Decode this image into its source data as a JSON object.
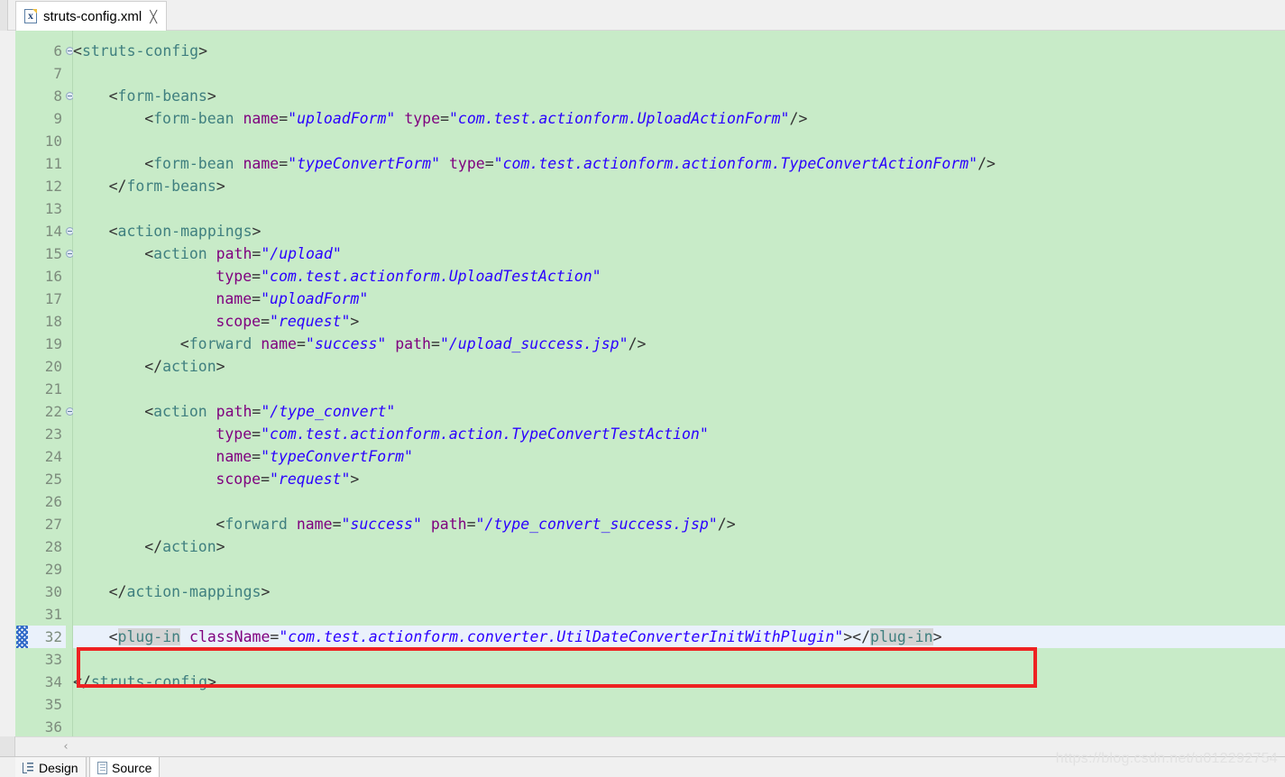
{
  "window": {
    "editor_tab": {
      "title": "struts-config.xml",
      "file_icon": "xml-file-icon",
      "close_icon": "close-icon"
    }
  },
  "editor": {
    "background_color": "#c8ebc8",
    "current_line_color": "#eaf1fb",
    "highlight_box_color": "#ee2222",
    "occurrence_color": "#d4d4d4",
    "colors": {
      "tag": "#3f7f7f",
      "attribute": "#7f007f",
      "value": "#2a00ff",
      "text": "#333333",
      "lineno": "#7d8c7d"
    },
    "first_line_number": 6,
    "current_line": 32,
    "lines": [
      {
        "n": 6,
        "fold": true,
        "indent": 0,
        "tokens": [
          {
            "t": "punc",
            "v": "<"
          },
          {
            "t": "tag",
            "v": "struts-config"
          },
          {
            "t": "punc",
            "v": ">"
          }
        ]
      },
      {
        "n": 7,
        "fold": false,
        "indent": 0,
        "tokens": []
      },
      {
        "n": 8,
        "fold": true,
        "indent": 1,
        "tokens": [
          {
            "t": "punc",
            "v": "<"
          },
          {
            "t": "tag",
            "v": "form-beans"
          },
          {
            "t": "punc",
            "v": ">"
          }
        ]
      },
      {
        "n": 9,
        "fold": false,
        "indent": 2,
        "tokens": [
          {
            "t": "punc",
            "v": "<"
          },
          {
            "t": "tag",
            "v": "form-bean"
          },
          {
            "t": "punc",
            "v": " "
          },
          {
            "t": "attr",
            "v": "name"
          },
          {
            "t": "punc",
            "v": "="
          },
          {
            "t": "val",
            "v": "\"uploadForm\""
          },
          {
            "t": "punc",
            "v": " "
          },
          {
            "t": "attr",
            "v": "type"
          },
          {
            "t": "punc",
            "v": "="
          },
          {
            "t": "val",
            "v": "\"com.test.actionform.UploadActionForm\""
          },
          {
            "t": "punc",
            "v": "/"
          },
          {
            "t": "punc",
            "v": ">"
          }
        ]
      },
      {
        "n": 10,
        "fold": false,
        "indent": 0,
        "tokens": []
      },
      {
        "n": 11,
        "fold": false,
        "indent": 2,
        "tokens": [
          {
            "t": "punc",
            "v": "<"
          },
          {
            "t": "tag",
            "v": "form-bean"
          },
          {
            "t": "punc",
            "v": " "
          },
          {
            "t": "attr",
            "v": "name"
          },
          {
            "t": "punc",
            "v": "="
          },
          {
            "t": "val",
            "v": "\"typeConvertForm\""
          },
          {
            "t": "punc",
            "v": " "
          },
          {
            "t": "attr",
            "v": "type"
          },
          {
            "t": "punc",
            "v": "="
          },
          {
            "t": "val",
            "v": "\"com.test.actionform.actionform.TypeConvertActionForm\""
          },
          {
            "t": "punc",
            "v": "/"
          },
          {
            "t": "punc",
            "v": ">"
          }
        ]
      },
      {
        "n": 12,
        "fold": false,
        "indent": 1,
        "tokens": [
          {
            "t": "punc",
            "v": "</"
          },
          {
            "t": "tag",
            "v": "form-beans"
          },
          {
            "t": "punc",
            "v": ">"
          }
        ]
      },
      {
        "n": 13,
        "fold": false,
        "indent": 0,
        "tokens": []
      },
      {
        "n": 14,
        "fold": true,
        "indent": 1,
        "tokens": [
          {
            "t": "punc",
            "v": "<"
          },
          {
            "t": "tag",
            "v": "action-mappings"
          },
          {
            "t": "punc",
            "v": ">"
          }
        ]
      },
      {
        "n": 15,
        "fold": true,
        "indent": 2,
        "tokens": [
          {
            "t": "punc",
            "v": "<"
          },
          {
            "t": "tag",
            "v": "action"
          },
          {
            "t": "punc",
            "v": " "
          },
          {
            "t": "attr",
            "v": "path"
          },
          {
            "t": "punc",
            "v": "="
          },
          {
            "t": "val",
            "v": "\"/upload\""
          }
        ]
      },
      {
        "n": 16,
        "fold": false,
        "indent": 4,
        "tokens": [
          {
            "t": "attr",
            "v": "type"
          },
          {
            "t": "punc",
            "v": "="
          },
          {
            "t": "val",
            "v": "\"com.test.actionform.UploadTestAction\""
          }
        ]
      },
      {
        "n": 17,
        "fold": false,
        "indent": 4,
        "tokens": [
          {
            "t": "attr",
            "v": "name"
          },
          {
            "t": "punc",
            "v": "="
          },
          {
            "t": "val",
            "v": "\"uploadForm\""
          }
        ]
      },
      {
        "n": 18,
        "fold": false,
        "indent": 4,
        "tokens": [
          {
            "t": "attr",
            "v": "scope"
          },
          {
            "t": "punc",
            "v": "="
          },
          {
            "t": "val",
            "v": "\"request\""
          },
          {
            "t": "punc",
            "v": ">"
          }
        ]
      },
      {
        "n": 19,
        "fold": false,
        "indent": 3,
        "tokens": [
          {
            "t": "punc",
            "v": "<"
          },
          {
            "t": "tag",
            "v": "forward"
          },
          {
            "t": "punc",
            "v": " "
          },
          {
            "t": "attr",
            "v": "name"
          },
          {
            "t": "punc",
            "v": "="
          },
          {
            "t": "val",
            "v": "\"success\""
          },
          {
            "t": "punc",
            "v": " "
          },
          {
            "t": "attr",
            "v": "path"
          },
          {
            "t": "punc",
            "v": "="
          },
          {
            "t": "val",
            "v": "\"/upload_success.jsp\""
          },
          {
            "t": "punc",
            "v": "/"
          },
          {
            "t": "punc",
            "v": ">"
          }
        ]
      },
      {
        "n": 20,
        "fold": false,
        "indent": 2,
        "tokens": [
          {
            "t": "punc",
            "v": "</"
          },
          {
            "t": "tag",
            "v": "action"
          },
          {
            "t": "punc",
            "v": ">"
          }
        ]
      },
      {
        "n": 21,
        "fold": false,
        "indent": 0,
        "tokens": []
      },
      {
        "n": 22,
        "fold": true,
        "indent": 2,
        "tokens": [
          {
            "t": "punc",
            "v": "<"
          },
          {
            "t": "tag",
            "v": "action"
          },
          {
            "t": "punc",
            "v": " "
          },
          {
            "t": "attr",
            "v": "path"
          },
          {
            "t": "punc",
            "v": "="
          },
          {
            "t": "val",
            "v": "\"/type_convert\""
          }
        ]
      },
      {
        "n": 23,
        "fold": false,
        "indent": 4,
        "tokens": [
          {
            "t": "attr",
            "v": "type"
          },
          {
            "t": "punc",
            "v": "="
          },
          {
            "t": "val",
            "v": "\"com.test.actionform.action.TypeConvertTestAction\""
          }
        ]
      },
      {
        "n": 24,
        "fold": false,
        "indent": 4,
        "tokens": [
          {
            "t": "attr",
            "v": "name"
          },
          {
            "t": "punc",
            "v": "="
          },
          {
            "t": "val",
            "v": "\"typeConvertForm\""
          }
        ]
      },
      {
        "n": 25,
        "fold": false,
        "indent": 4,
        "tokens": [
          {
            "t": "attr",
            "v": "scope"
          },
          {
            "t": "punc",
            "v": "="
          },
          {
            "t": "val",
            "v": "\"request\""
          },
          {
            "t": "punc",
            "v": ">"
          }
        ]
      },
      {
        "n": 26,
        "fold": false,
        "indent": 0,
        "tokens": []
      },
      {
        "n": 27,
        "fold": false,
        "indent": 4,
        "tokens": [
          {
            "t": "punc",
            "v": "<"
          },
          {
            "t": "tag",
            "v": "forward"
          },
          {
            "t": "punc",
            "v": " "
          },
          {
            "t": "attr",
            "v": "name"
          },
          {
            "t": "punc",
            "v": "="
          },
          {
            "t": "val",
            "v": "\"success\""
          },
          {
            "t": "punc",
            "v": " "
          },
          {
            "t": "attr",
            "v": "path"
          },
          {
            "t": "punc",
            "v": "="
          },
          {
            "t": "val",
            "v": "\"/type_convert_success.jsp\""
          },
          {
            "t": "punc",
            "v": "/"
          },
          {
            "t": "punc",
            "v": ">"
          }
        ]
      },
      {
        "n": 28,
        "fold": false,
        "indent": 2,
        "tokens": [
          {
            "t": "punc",
            "v": "</"
          },
          {
            "t": "tag",
            "v": "action"
          },
          {
            "t": "punc",
            "v": ">"
          }
        ]
      },
      {
        "n": 29,
        "fold": false,
        "indent": 0,
        "tokens": []
      },
      {
        "n": 30,
        "fold": false,
        "indent": 1,
        "tokens": [
          {
            "t": "punc",
            "v": "</"
          },
          {
            "t": "tag",
            "v": "action-mappings"
          },
          {
            "t": "punc",
            "v": ">"
          }
        ]
      },
      {
        "n": 31,
        "fold": false,
        "indent": 0,
        "tokens": []
      },
      {
        "n": 32,
        "fold": false,
        "indent": 1,
        "current": true,
        "marker": true,
        "tokens": [
          {
            "t": "punc",
            "v": "<"
          },
          {
            "t": "tag occ",
            "v": "plug-in"
          },
          {
            "t": "punc",
            "v": " "
          },
          {
            "t": "attr",
            "v": "className"
          },
          {
            "t": "punc",
            "v": "="
          },
          {
            "t": "val",
            "v": "\"com.test.actionform.converter.UtilDateConverterInitWithPlugin\""
          },
          {
            "t": "punc",
            "v": ">"
          },
          {
            "t": "punc",
            "v": "</"
          },
          {
            "t": "tag occ",
            "v": "plug-in"
          },
          {
            "t": "punc",
            "v": ">"
          }
        ]
      },
      {
        "n": 33,
        "fold": false,
        "indent": 0,
        "tokens": []
      },
      {
        "n": 34,
        "fold": false,
        "indent": 0,
        "tokens": [
          {
            "t": "punc",
            "v": "</"
          },
          {
            "t": "tag",
            "v": "struts-config"
          },
          {
            "t": "punc",
            "v": ">"
          }
        ]
      },
      {
        "n": 35,
        "fold": false,
        "indent": 0,
        "tokens": []
      },
      {
        "n": 36,
        "fold": false,
        "indent": 0,
        "tokens": []
      }
    ]
  },
  "scrollbar": {
    "left_arrow_glyph": "‹"
  },
  "bottom_tabs": [
    {
      "label": "Design",
      "icon": "design-tree-icon",
      "active": false
    },
    {
      "label": "Source",
      "icon": "source-document-icon",
      "active": true
    }
  ],
  "watermark": {
    "text": "https://blog.csdn.net/u012292754"
  }
}
